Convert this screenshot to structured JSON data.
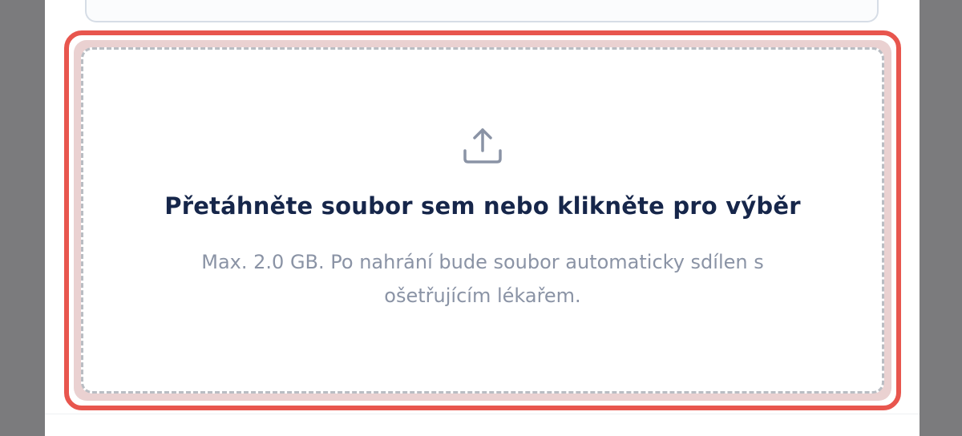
{
  "upload": {
    "icon": "upload-icon",
    "title": "Přetáhněte soubor sem nebo klikněte pro výběr",
    "hint_line1": "Max. 2.0 GB. Po nahrání bude soubor automaticky sdílen s",
    "hint_line2": "ošetřujícím lékařem."
  },
  "colors": {
    "focus_ring": "#e8564e",
    "title": "#16264a",
    "hint": "#8a93a5",
    "backdrop": "#7b7b7d"
  }
}
